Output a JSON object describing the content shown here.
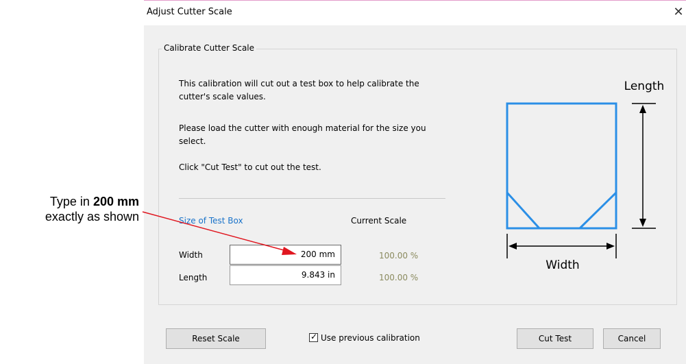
{
  "annotation": {
    "prefix": "Type in ",
    "bold": "200 mm",
    "line2": "exactly as shown"
  },
  "dialog": {
    "title": "Adjust Cutter Scale",
    "close_glyph": "✕",
    "group_title": "Calibrate Cutter Scale",
    "desc1_line1": "This calibration will cut out a test box to help calibrate the",
    "desc1_line2": "cutter's scale values.",
    "desc2_line1": "Please load the cutter with enough material for the size you",
    "desc2_line2": "select.",
    "desc3": "Click \"Cut Test\" to cut out the test.",
    "size_section": "Size of Test Box",
    "scale_section": "Current Scale",
    "width_label": "Width",
    "length_label": "Length",
    "width_value": "200 mm",
    "length_value": "9.843 in",
    "width_scale": "100.00 %",
    "length_scale": "100.00 %",
    "diagram_length": "Length",
    "diagram_width": "Width",
    "reset_button": "Reset Scale",
    "checkbox_label": "Use previous calibration",
    "checkbox_checked": true,
    "cut_test_button": "Cut Test",
    "cancel_button": "Cancel"
  },
  "colors": {
    "box_outline": "#2b8fe6",
    "section_link": "#1a73c9",
    "arrow": "#e0161f"
  }
}
